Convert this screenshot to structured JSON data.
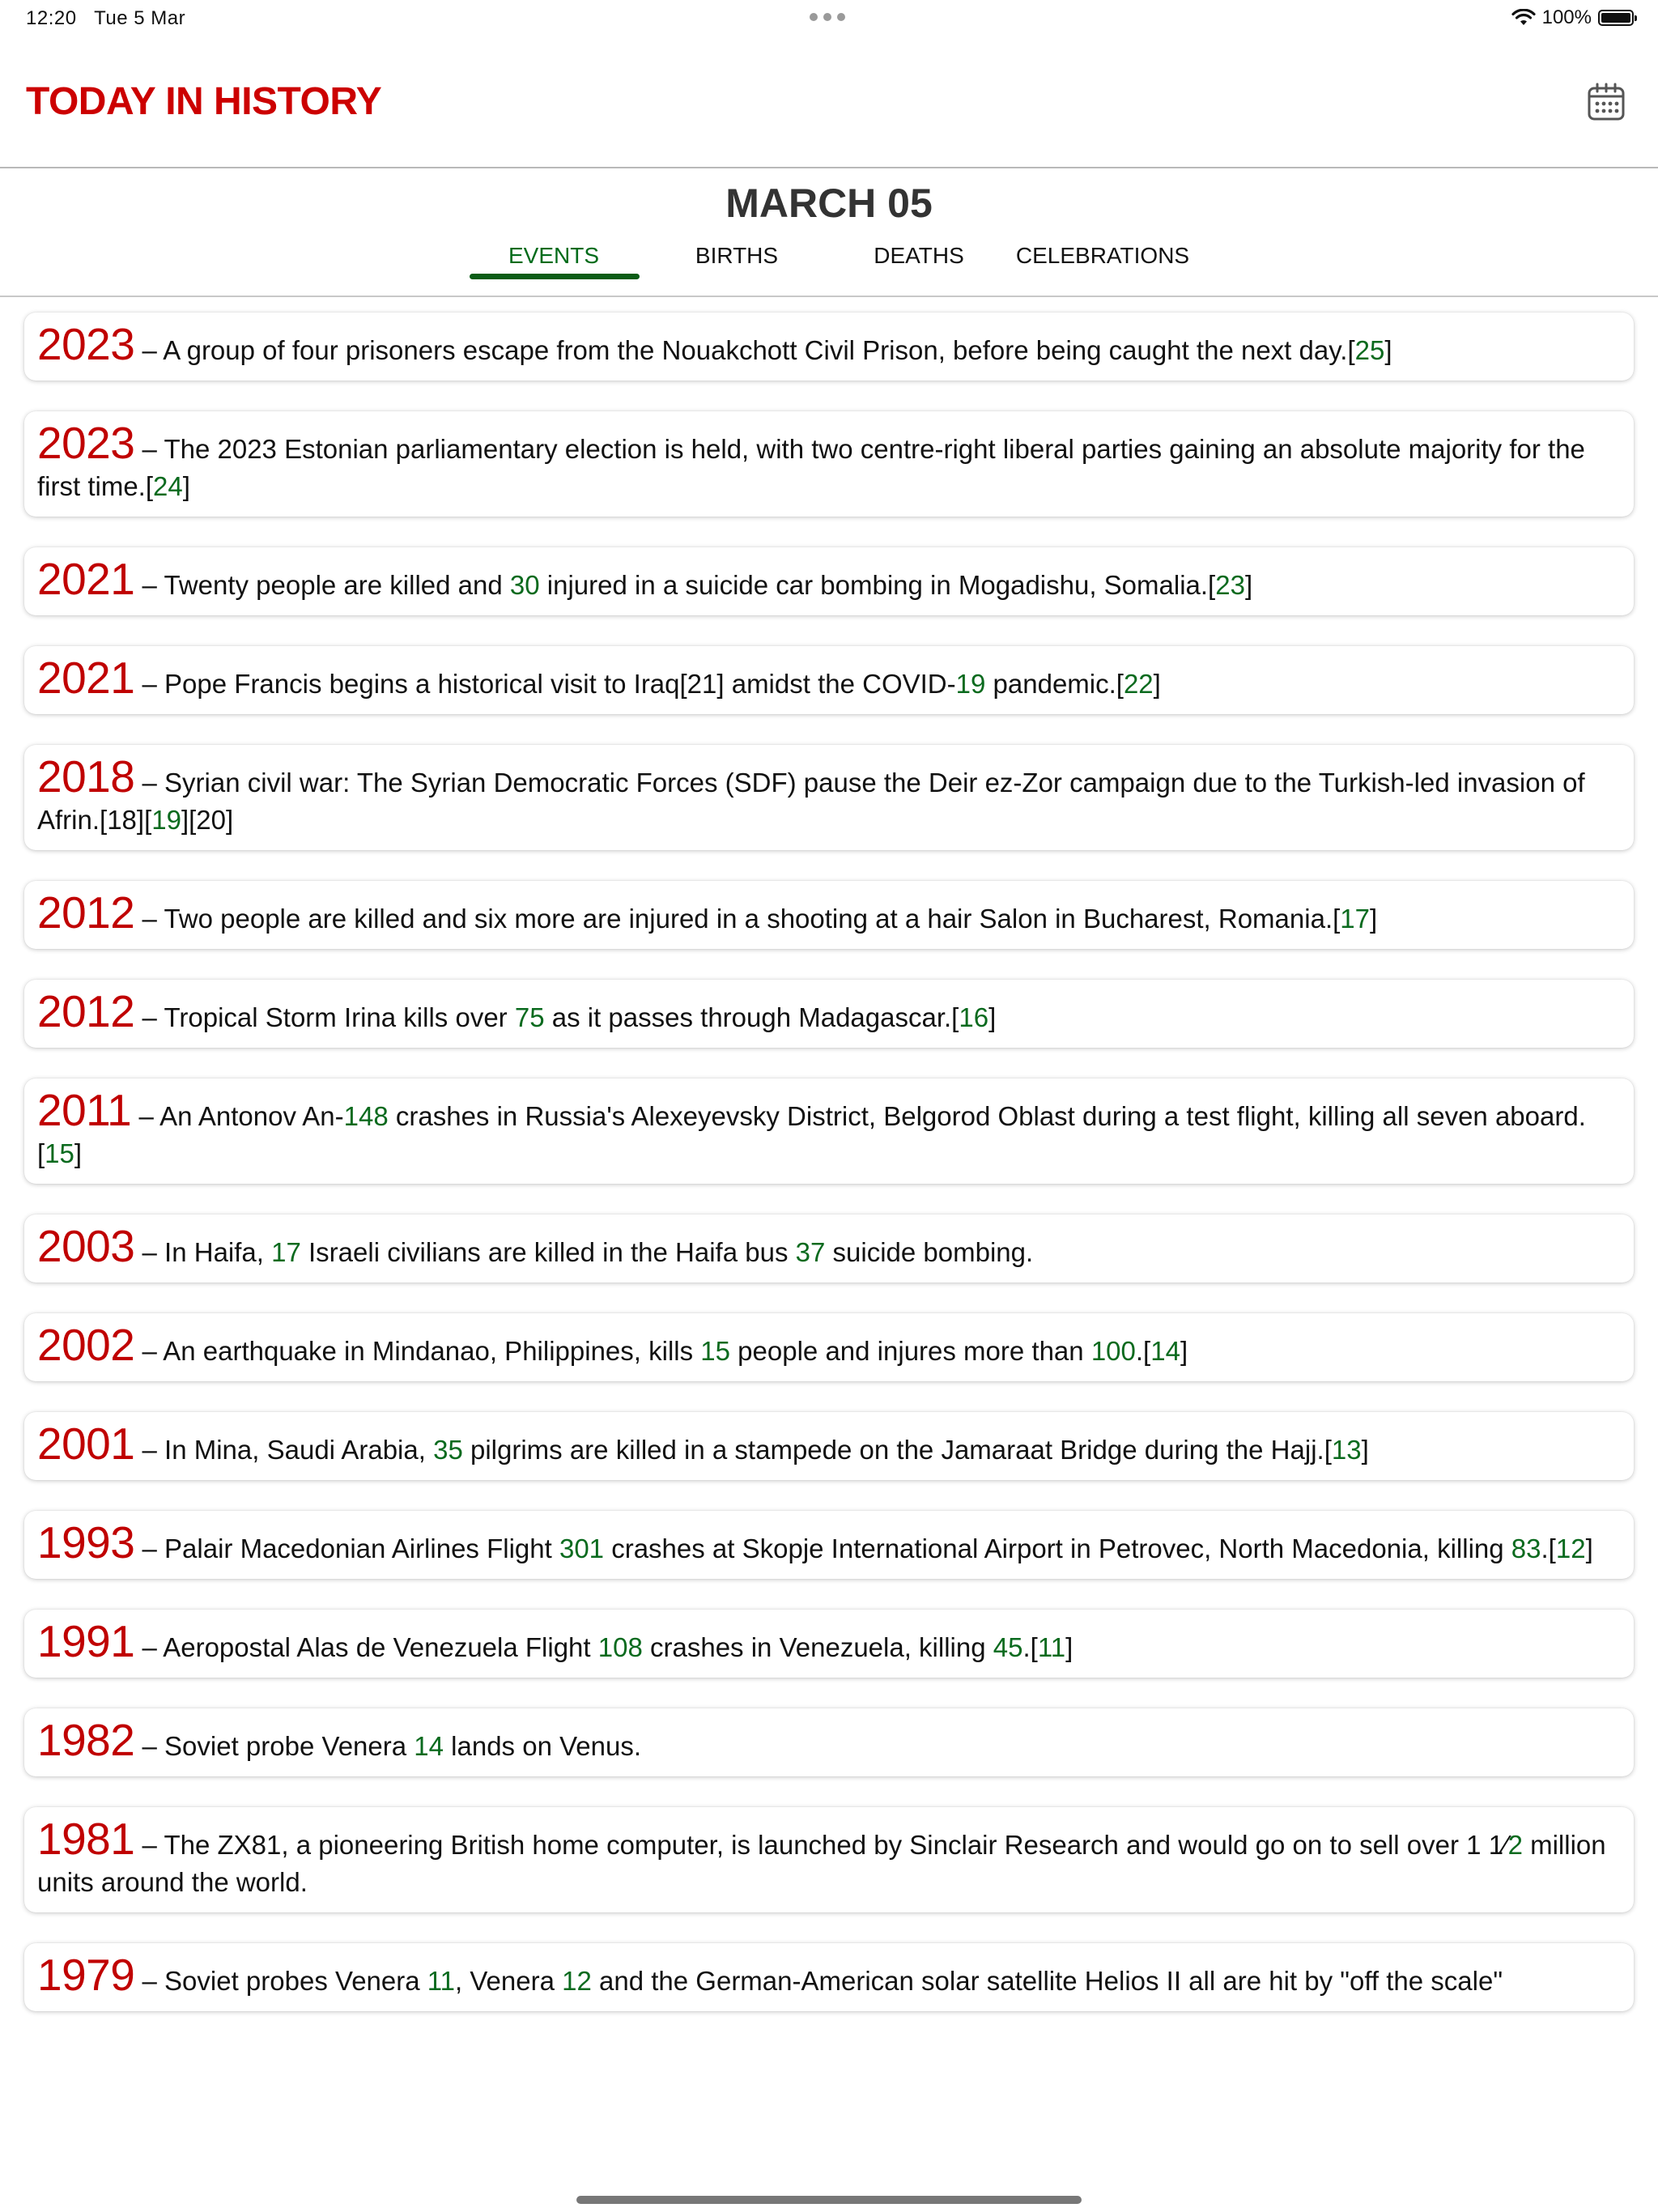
{
  "status_bar": {
    "time": "12:20",
    "date": "Tue 5 Mar",
    "battery": "100%",
    "battery_level": 1.0
  },
  "header": {
    "title": "TODAY IN HISTORY",
    "calendar_icon": "calendar-icon"
  },
  "date_heading": "MARCH 05",
  "tabs": [
    {
      "label": "EVENTS",
      "active": true
    },
    {
      "label": "BIRTHS",
      "active": false
    },
    {
      "label": "DEATHS",
      "active": false
    },
    {
      "label": "CELEBRATIONS",
      "active": false
    }
  ],
  "colors": {
    "title": "#cc0000",
    "year": "#c00000",
    "accent_green": "#0a6a1e"
  },
  "events": [
    {
      "year": "2023",
      "parts": [
        {
          "t": " – A group of four prisoners escape from the Nouakchott Civil Prison, before being caught the next day.["
        },
        {
          "t": "25",
          "n": true
        },
        {
          "t": "]"
        }
      ]
    },
    {
      "year": "2023",
      "parts": [
        {
          "t": " – The 2023 Estonian parliamentary election is held, with two centre-right liberal parties gaining an absolute majority for the first time.["
        },
        {
          "t": "24",
          "n": true
        },
        {
          "t": "]"
        }
      ]
    },
    {
      "year": "2021",
      "parts": [
        {
          "t": " – Twenty people are killed and "
        },
        {
          "t": "30",
          "n": true
        },
        {
          "t": " injured in a suicide car bombing in Mogadishu, Somalia.["
        },
        {
          "t": "23",
          "n": true
        },
        {
          "t": "]"
        }
      ]
    },
    {
      "year": "2021",
      "parts": [
        {
          "t": " – Pope Francis begins a historical visit to Iraq[21] amidst the COVID-"
        },
        {
          "t": "19",
          "n": true
        },
        {
          "t": " pandemic.["
        },
        {
          "t": "22",
          "n": true
        },
        {
          "t": "]"
        }
      ]
    },
    {
      "year": "2018",
      "parts": [
        {
          "t": " – Syrian civil war: The Syrian Democratic Forces (SDF) pause the Deir ez-Zor campaign due to the Turkish-led invasion of Afrin.[18]["
        },
        {
          "t": "19",
          "n": true
        },
        {
          "t": "][20]"
        }
      ]
    },
    {
      "year": "2012",
      "parts": [
        {
          "t": " – Two people are killed and six more are injured in a shooting at a hair Salon in Bucharest, Romania.["
        },
        {
          "t": "17",
          "n": true
        },
        {
          "t": "]"
        }
      ]
    },
    {
      "year": "2012",
      "parts": [
        {
          "t": " – Tropical Storm Irina kills over "
        },
        {
          "t": "75",
          "n": true
        },
        {
          "t": " as it passes through Madagascar.["
        },
        {
          "t": "16",
          "n": true
        },
        {
          "t": "]"
        }
      ]
    },
    {
      "year": "2011",
      "parts": [
        {
          "t": " – An Antonov An-"
        },
        {
          "t": "148",
          "n": true
        },
        {
          "t": " crashes in Russia's Alexeyevsky District, Belgorod Oblast during a test flight, killing all seven aboard.["
        },
        {
          "t": "15",
          "n": true
        },
        {
          "t": "]"
        }
      ]
    },
    {
      "year": "2003",
      "parts": [
        {
          "t": " – In Haifa, "
        },
        {
          "t": "17",
          "n": true
        },
        {
          "t": " Israeli civilians are killed in the Haifa bus "
        },
        {
          "t": "37",
          "n": true
        },
        {
          "t": " suicide bombing."
        }
      ]
    },
    {
      "year": "2002",
      "parts": [
        {
          "t": " – An earthquake in Mindanao, Philippines, kills "
        },
        {
          "t": "15",
          "n": true
        },
        {
          "t": " people and injures more than "
        },
        {
          "t": "100",
          "n": true
        },
        {
          "t": ".["
        },
        {
          "t": "14",
          "n": true
        },
        {
          "t": "]"
        }
      ]
    },
    {
      "year": "2001",
      "parts": [
        {
          "t": " – In Mina, Saudi Arabia, "
        },
        {
          "t": "35",
          "n": true
        },
        {
          "t": " pilgrims are killed in a stampede on the Jamaraat Bridge during the Hajj.["
        },
        {
          "t": "13",
          "n": true
        },
        {
          "t": "]"
        }
      ]
    },
    {
      "year": "1993",
      "parts": [
        {
          "t": " – Palair Macedonian Airlines Flight "
        },
        {
          "t": "301",
          "n": true
        },
        {
          "t": " crashes at Skopje International Airport in Petrovec, North Macedonia, killing "
        },
        {
          "t": "83",
          "n": true
        },
        {
          "t": ".["
        },
        {
          "t": "12",
          "n": true
        },
        {
          "t": "]"
        }
      ]
    },
    {
      "year": "1991",
      "parts": [
        {
          "t": " – Aeropostal Alas de Venezuela Flight "
        },
        {
          "t": "108",
          "n": true
        },
        {
          "t": " crashes in Venezuela, killing "
        },
        {
          "t": "45",
          "n": true
        },
        {
          "t": ".["
        },
        {
          "t": "11",
          "n": true
        },
        {
          "t": "]"
        }
      ]
    },
    {
      "year": "1982",
      "parts": [
        {
          "t": " – Soviet probe Venera "
        },
        {
          "t": "14",
          "n": true
        },
        {
          "t": " lands on Venus."
        }
      ]
    },
    {
      "year": "1981",
      "parts": [
        {
          "t": " – The ZX81, a pioneering British home computer, is launched by Sinclair Research and would go on to sell over 1 1⁄"
        },
        {
          "t": "2",
          "n": true
        },
        {
          "t": " million units around the world."
        }
      ]
    },
    {
      "year": "1979",
      "parts": [
        {
          "t": " – Soviet probes Venera "
        },
        {
          "t": "11",
          "n": true
        },
        {
          "t": ", Venera "
        },
        {
          "t": "12",
          "n": true
        },
        {
          "t": " and the German-American solar satellite Helios II all are hit by \"off the scale\""
        }
      ]
    }
  ]
}
